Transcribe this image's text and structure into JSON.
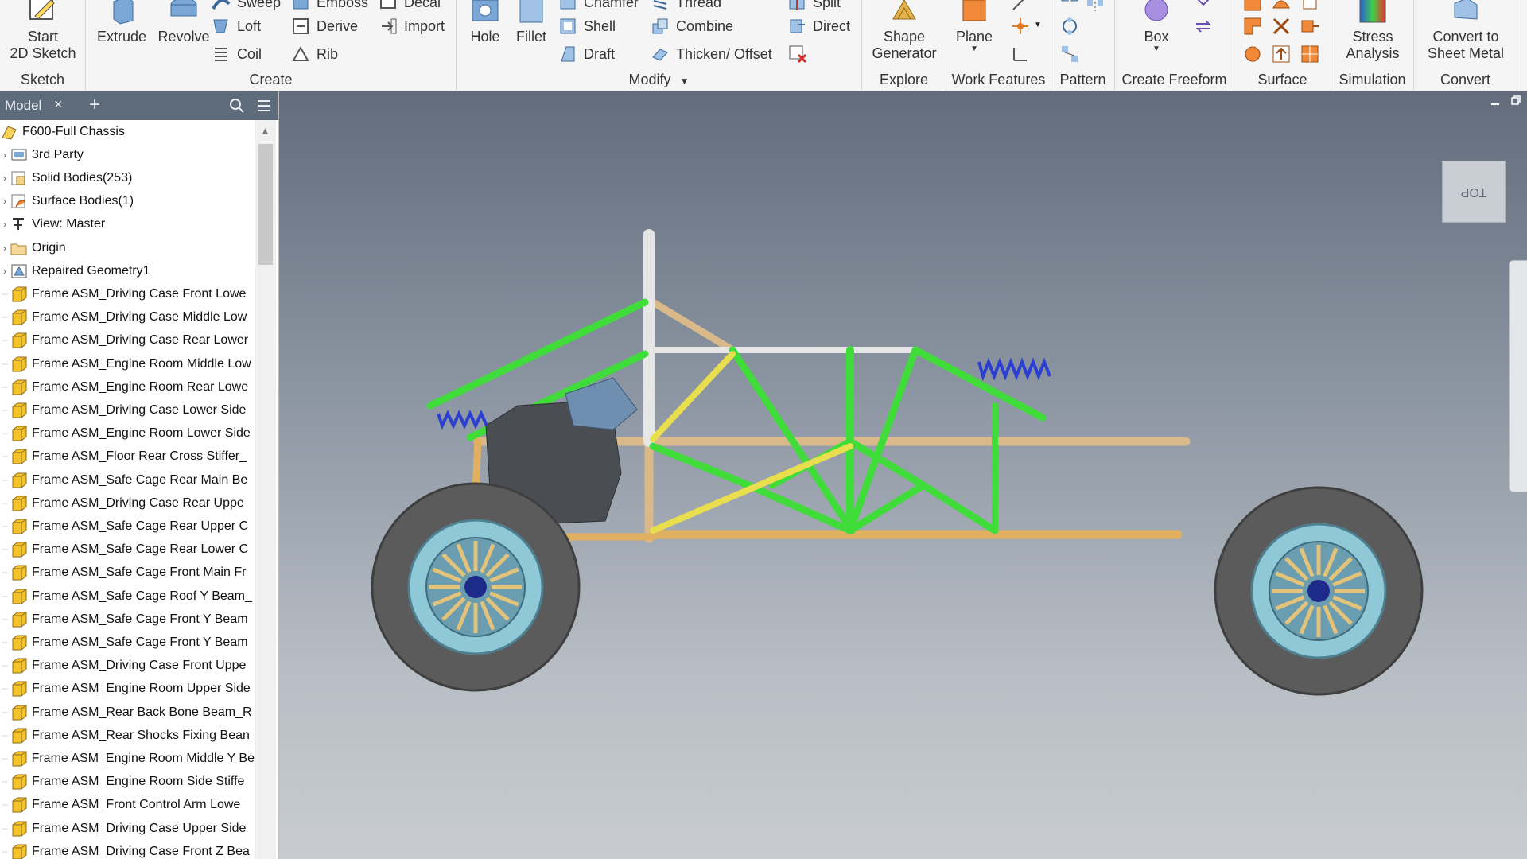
{
  "ribbon": {
    "sketch": {
      "group_label": "Sketch",
      "start_sketch": "Start\n2D Sketch"
    },
    "create": {
      "group_label": "Create",
      "extrude": "Extrude",
      "revolve": "Revolve",
      "sweep": "Sweep",
      "loft": "Loft",
      "coil": "Coil",
      "emboss": "Emboss",
      "derive": "Derive",
      "rib": "Rib",
      "decal": "Decal",
      "import": "Import"
    },
    "modify": {
      "group_label": "Modify",
      "hole": "Hole",
      "fillet": "Fillet",
      "chamfer": "Chamfer",
      "shell": "Shell",
      "draft": "Draft",
      "thread": "Thread",
      "combine": "Combine",
      "thicken": "Thicken/ Offset",
      "split": "Split",
      "direct": "Direct"
    },
    "explore": {
      "group_label": "Explore",
      "shape_generator": "Shape\nGenerator"
    },
    "work_features": {
      "group_label": "Work Features",
      "plane": "Plane"
    },
    "pattern": {
      "group_label": "Pattern"
    },
    "create_freeform": {
      "group_label": "Create Freeform",
      "box": "Box"
    },
    "surface": {
      "group_label": "Surface"
    },
    "simulation": {
      "group_label": "Simulation",
      "stress_analysis": "Stress\nAnalysis"
    },
    "convert": {
      "group_label": "Convert",
      "convert_sheet_metal": "Convert to\nSheet Metal"
    }
  },
  "browser": {
    "tab_label": "Model",
    "close_glyph": "×",
    "add_glyph": "+",
    "root": "F600-Full Chassis",
    "folders": [
      {
        "label": "3rd Party",
        "icon": "3rd-party-icon"
      },
      {
        "label": "Solid Bodies(253)",
        "icon": "solid-bodies-icon"
      },
      {
        "label": "Surface Bodies(1)",
        "icon": "surface-bodies-icon"
      },
      {
        "label": "View: Master",
        "icon": "view-icon"
      },
      {
        "label": "Origin",
        "icon": "folder-icon"
      },
      {
        "label": "Repaired Geometry1",
        "icon": "repaired-geometry-icon"
      }
    ],
    "frames": [
      "Frame ASM_Driving Case Front Lowe",
      "Frame ASM_Driving Case Middle Low",
      "Frame ASM_Driving Case Rear Lower",
      "Frame ASM_Engine Room Middle Low",
      "Frame ASM_Engine Room Rear Lowe",
      "Frame ASM_Driving Case Lower Side",
      "Frame ASM_Engine Room Lower Side",
      "Frame ASM_Floor Rear Cross Stiffer_",
      "Frame ASM_Safe Cage Rear Main Be",
      "Frame ASM_Driving Case Rear Uppe",
      "Frame ASM_Safe Cage Rear Upper C",
      "Frame ASM_Safe Cage Rear Lower C",
      "Frame ASM_Safe Cage Front Main Fr",
      "Frame ASM_Safe Cage Roof Y Beam_",
      "Frame ASM_Safe Cage Front Y Beam",
      "Frame ASM_Safe Cage Front Y Beam",
      "Frame ASM_Driving Case Front Uppe",
      "Frame ASM_Engine Room Upper Side",
      "Frame ASM_Rear Back Bone Beam_R",
      "Frame ASM_Rear Shocks Fixing Bean",
      "Frame ASM_Engine Room Middle Y Be",
      "Frame ASM_Engine Room Side Stiffe",
      "Frame ASM_Front Control Arm Lowe",
      "Frame ASM_Driving Case Upper Side",
      "Frame ASM_Driving Case Front Z Bea"
    ]
  },
  "viewport": {
    "viewcube_face": "TOP"
  },
  "colors": {
    "ribbon_bg": "#f5f5f5",
    "panel_header": "#5d6b7a",
    "frame_green": "#3fdc3a",
    "frame_tan": "#d9b98a",
    "frame_yellow": "#e8de4e",
    "frame_white": "#e6e6e6",
    "tire": "#5b5b5b",
    "rim": "#8fc8d6"
  }
}
